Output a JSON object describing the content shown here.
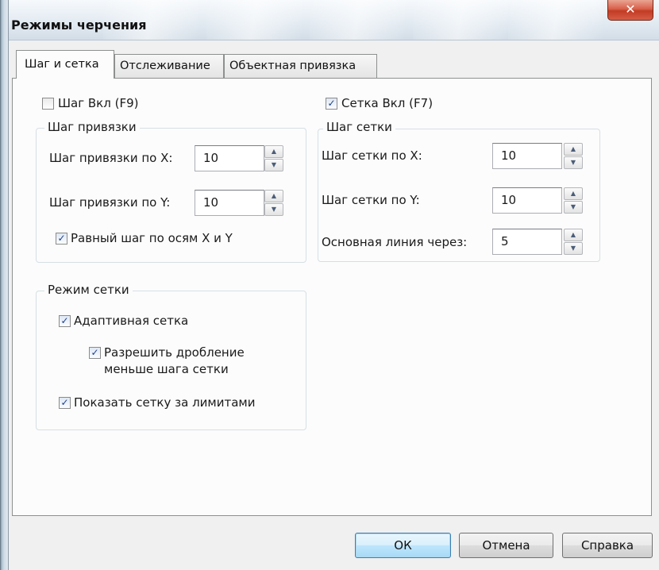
{
  "window": {
    "title": "Режимы черчения",
    "close_glyph": "✕"
  },
  "tabs": [
    {
      "label": "Шаг и сетка",
      "active": true
    },
    {
      "label": "Отслеживание",
      "active": false
    },
    {
      "label": "Объектная привязка",
      "active": false
    }
  ],
  "snap": {
    "toggle": {
      "label": "Шаг Вкл (F9)",
      "checked": false
    },
    "group_title": "Шаг привязки",
    "x_label": "Шаг привязки по X:",
    "x_value": "10",
    "y_label": "Шаг привязки по Y:",
    "y_value": "10",
    "equal": {
      "label": "Равный шаг по осям X и Y",
      "checked": true
    }
  },
  "grid": {
    "toggle": {
      "label": "Сетка Вкл (F7)",
      "checked": true
    },
    "group_title": "Шаг сетки",
    "x_label": "Шаг сетки по X:",
    "x_value": "10",
    "y_label": "Шаг сетки по Y:",
    "y_value": "10",
    "major_label": "Основная линия через:",
    "major_value": "5"
  },
  "grid_mode": {
    "group_title": "Режим сетки",
    "adaptive": {
      "label": "Адаптивная сетка",
      "checked": true
    },
    "subdivide": {
      "label_line1": "Разрешить дробление",
      "label_line2": "меньше шага сетки",
      "checked": true
    },
    "beyond_limits": {
      "label": "Показать сетку за лимитами",
      "checked": true
    }
  },
  "buttons": {
    "ok": "ОК",
    "cancel": "Отмена",
    "help": "Справка"
  },
  "icons": {
    "check": "✓",
    "spin_up": "▲",
    "spin_down": "▼"
  },
  "colors": {
    "title_close": "#c8442e",
    "default_button": "#bee6fd",
    "check_mark": "#1e3f8a"
  }
}
